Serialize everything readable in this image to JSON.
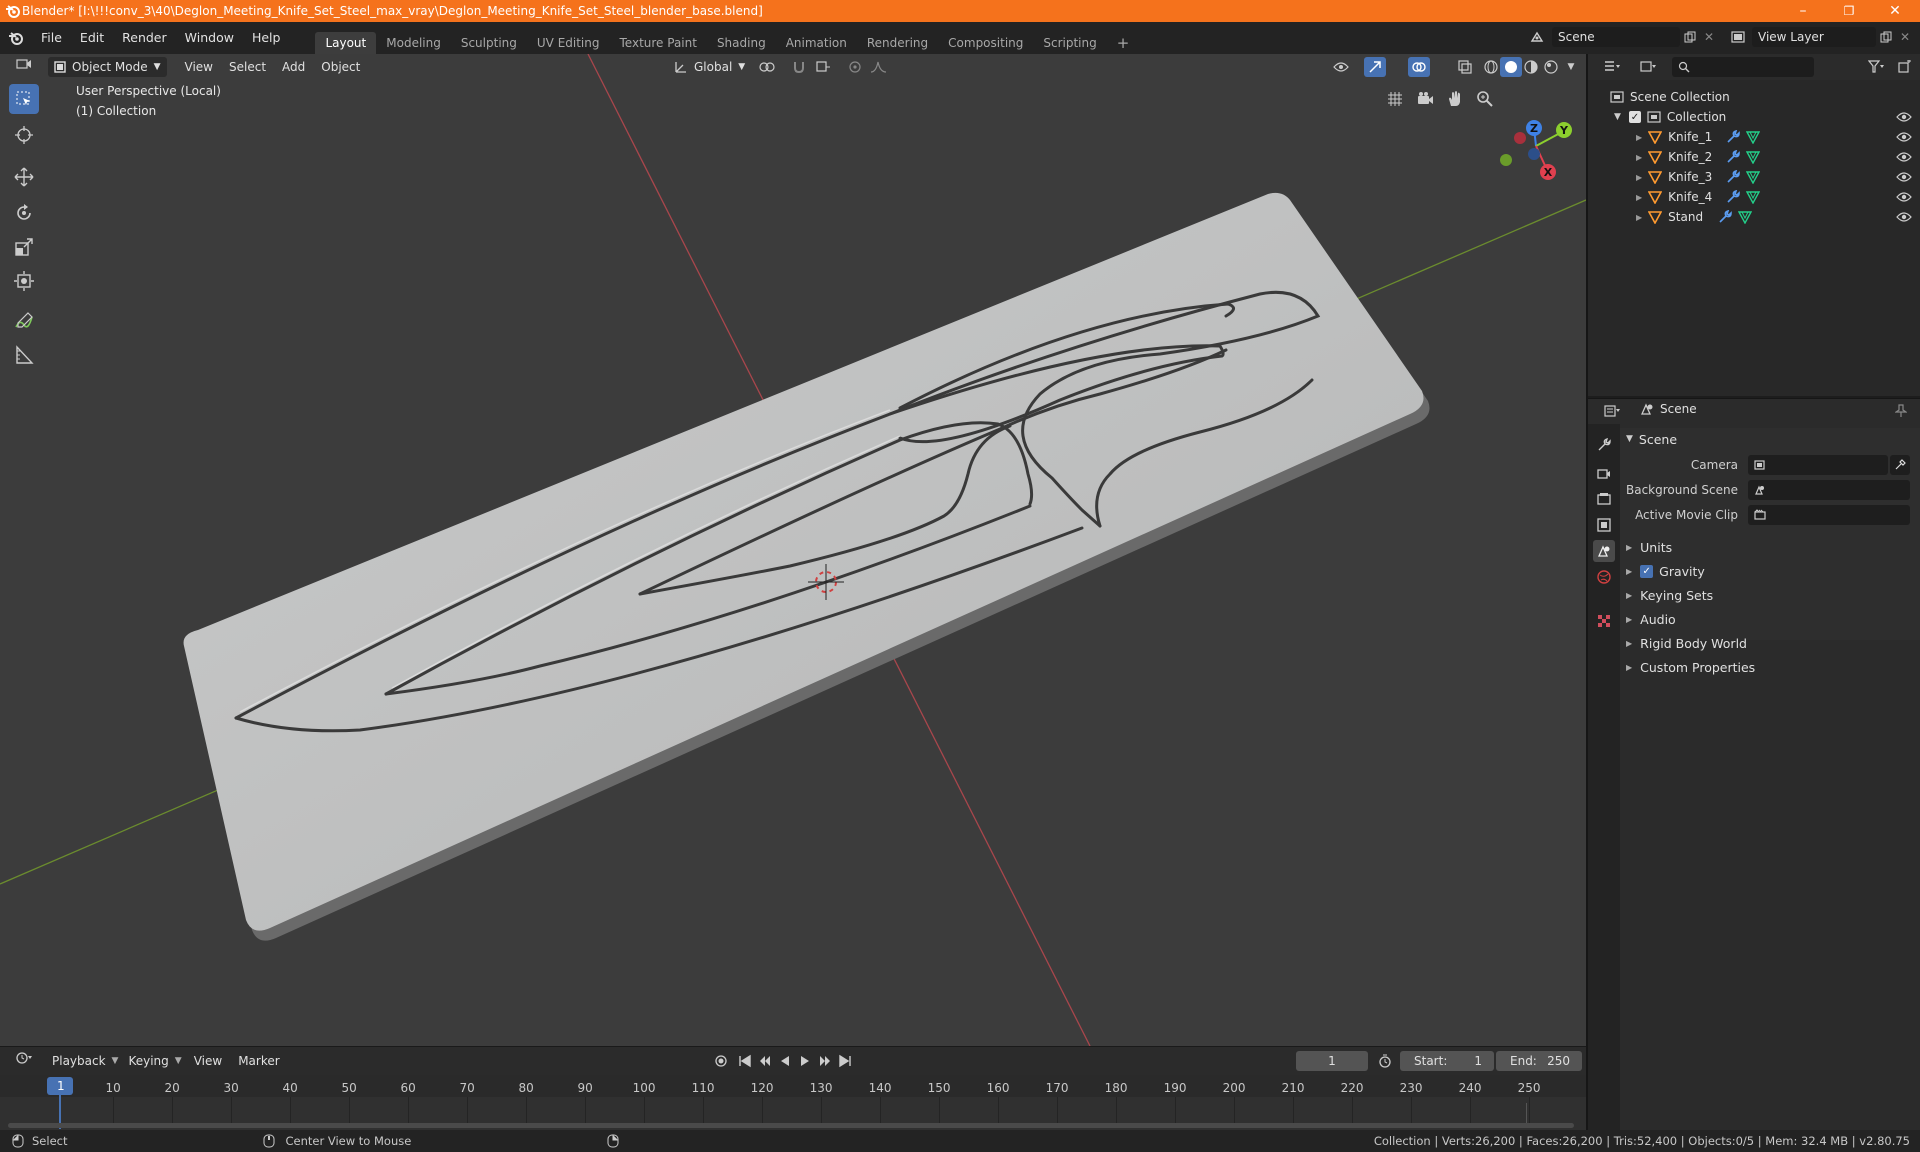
{
  "window": {
    "title": "Blender* [I:\\!!!conv_3\\40\\Deglon_Meeting_Knife_Set_Steel_max_vray\\Deglon_Meeting_Knife_Set_Steel_blender_base.blend]",
    "minimize": "–",
    "maximize": "❐",
    "close": "✕"
  },
  "menubar": {
    "items": [
      "File",
      "Edit",
      "Render",
      "Window",
      "Help"
    ],
    "workspaces": [
      "Layout",
      "Modeling",
      "Sculpting",
      "UV Editing",
      "Texture Paint",
      "Shading",
      "Animation",
      "Rendering",
      "Compositing",
      "Scripting"
    ],
    "add_workspace": "+",
    "scene_label": "Scene",
    "view_layer_label": "View Layer"
  },
  "viewport": {
    "mode": "Object Mode",
    "menus": [
      "View",
      "Select",
      "Add",
      "Object"
    ],
    "transform_orientation": "Global",
    "perspective_label": "User Perspective (Local)",
    "collection_label": "(1) Collection",
    "gizmo_axes": {
      "x": "X",
      "y": "Y",
      "z": "Z"
    }
  },
  "outliner": {
    "search_placeholder": "",
    "scene_collection": "Scene Collection",
    "collection": "Collection",
    "objects": [
      "Knife_1",
      "Knife_2",
      "Knife_3",
      "Knife_4",
      "Stand"
    ]
  },
  "properties": {
    "header_title": "Scene",
    "section_scene": "Scene",
    "camera_label": "Camera",
    "camera_value": "",
    "background_scene_label": "Background Scene",
    "background_scene_value": "",
    "active_movie_clip_label": "Active Movie Clip",
    "active_movie_clip_value": "",
    "panels": {
      "units": "Units",
      "gravity": "Gravity",
      "keying_sets": "Keying Sets",
      "audio": "Audio",
      "rigid_body_world": "Rigid Body World",
      "custom_properties": "Custom Properties"
    },
    "gravity_enabled": true
  },
  "timeline": {
    "menus": [
      "Playback",
      "Keying",
      "View",
      "Marker"
    ],
    "current_frame": "1",
    "start_label": "Start:",
    "start_value": "1",
    "end_label": "End:",
    "end_value": "250",
    "ticks": [
      "1",
      "10",
      "20",
      "30",
      "40",
      "50",
      "60",
      "70",
      "80",
      "90",
      "100",
      "110",
      "120",
      "130",
      "140",
      "150",
      "160",
      "170",
      "180",
      "190",
      "200",
      "210",
      "220",
      "230",
      "240",
      "250"
    ]
  },
  "statusbar": {
    "left_action": "Select",
    "middle_action": "Center View to Mouse",
    "stats": "Collection | Verts:26,200 | Faces:26,200 | Tris:52,400 | Objects:0/5 | Mem: 32.4 MB | v2.80.75"
  },
  "colors": {
    "title_bar": "#f5721c",
    "accent_blue": "#4772b3",
    "axis_x": "#e0404f",
    "axis_y": "#8ccf2e",
    "axis_z": "#3f82e6",
    "object_orange": "#ff9b30",
    "modifier_blue": "#5b9cf0",
    "mesh_green": "#23d08a"
  }
}
